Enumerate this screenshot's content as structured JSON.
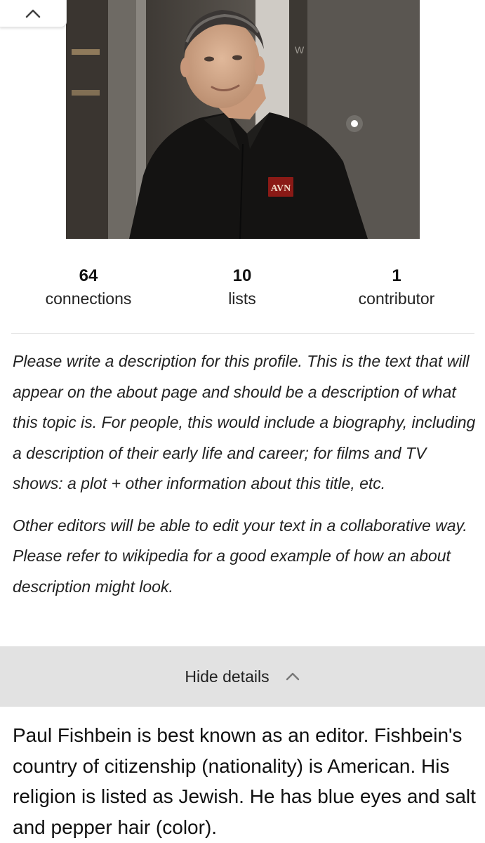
{
  "scroll_top": {
    "icon": "chevron-up-icon"
  },
  "profile_photo": {
    "badge_text": "AVN",
    "sign_text": "W"
  },
  "stats": [
    {
      "value": "64",
      "label": "connections"
    },
    {
      "value": "10",
      "label": "lists"
    },
    {
      "value": "1",
      "label": "contributor"
    }
  ],
  "description_prompt": {
    "paragraph_1": "Please write a description for this profile. This is the text that will appear on the about page and should be a description of what this topic is. For people, this would include a biography, including a description of their early life and career; for films and TV shows: a plot + other information about this title, etc.",
    "paragraph_2": "Other editors will be able to edit your text in a collaborative way. Please refer to wikipedia for a good example of how an about description might look."
  },
  "details_toggle": {
    "label": "Hide details",
    "icon": "chevron-up-icon"
  },
  "bio_text": "Paul Fishbein is best known as an editor. Fishbein's country of citizenship (nationality) is American. His religion is listed as Jewish. He has blue eyes and salt and pepper hair (color).",
  "colors": {
    "details_bar_bg": "#e2e2e2",
    "divider": "#e3e3e3",
    "text": "#222222"
  }
}
